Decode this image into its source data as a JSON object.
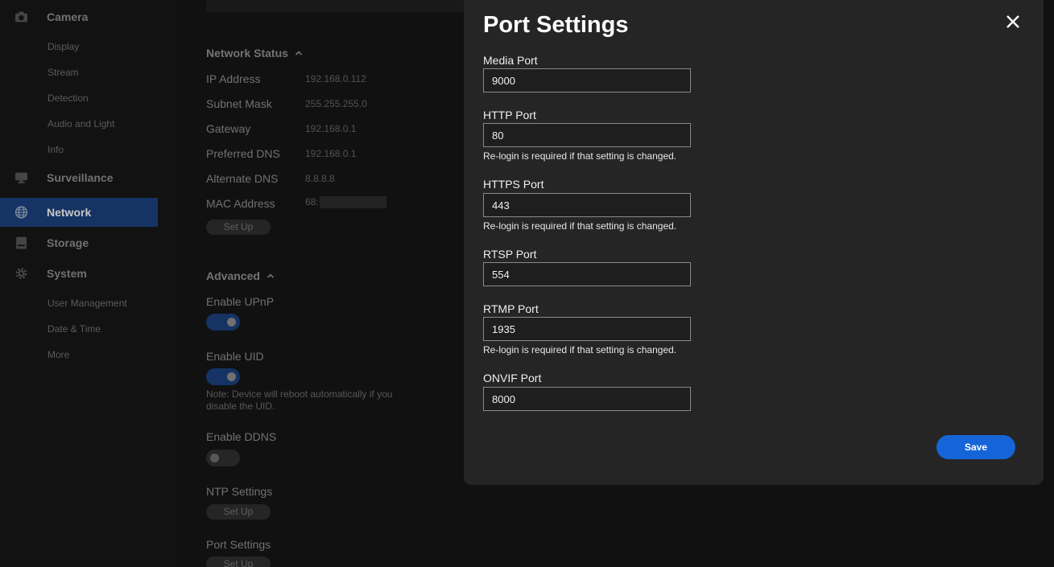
{
  "sidebar": {
    "groups": [
      {
        "label": "Camera",
        "icon": "camera-icon"
      },
      {
        "label": "Surveillance",
        "icon": "monitor-icon"
      },
      {
        "label": "Network",
        "icon": "globe-icon"
      },
      {
        "label": "Storage",
        "icon": "storage-icon"
      },
      {
        "label": "System",
        "icon": "gear-icon"
      }
    ],
    "camera_items": [
      "Display",
      "Stream",
      "Detection",
      "Audio and Light",
      "Info"
    ],
    "system_items": [
      "User Management",
      "Date & Time",
      "More"
    ]
  },
  "main": {
    "network_status": {
      "title": "Network Status",
      "rows": [
        {
          "label": "IP Address",
          "value": "192.168.0.112"
        },
        {
          "label": "Subnet Mask",
          "value": "255.255.255.0"
        },
        {
          "label": "Gateway",
          "value": "192.168.0.1"
        },
        {
          "label": "Preferred DNS",
          "value": "192.168.0.1"
        },
        {
          "label": "Alternate DNS",
          "value": "8.8.8.8"
        },
        {
          "label": "MAC Address",
          "value": "68:"
        }
      ],
      "setup_label": "Set Up"
    },
    "advanced": {
      "title": "Advanced",
      "upnp_label": "Enable UPnP",
      "uid_label": "Enable UID",
      "uid_note": "Note: Device will reboot automatically if you disable the UID.",
      "ddns_label": "Enable DDNS",
      "ntp_label": "NTP Settings",
      "ntp_setup": "Set Up",
      "port_label": "Port Settings",
      "port_setup": "Set Up"
    }
  },
  "modal": {
    "title": "Port Settings",
    "fields": [
      {
        "label": "Media Port",
        "value": "9000",
        "hint": ""
      },
      {
        "label": "HTTP Port",
        "value": "80",
        "hint": "Re-login is required if that setting is changed."
      },
      {
        "label": "HTTPS Port",
        "value": "443",
        "hint": "Re-login is required if that setting is changed."
      },
      {
        "label": "RTSP Port",
        "value": "554",
        "hint": ""
      },
      {
        "label": "RTMP Port",
        "value": "1935",
        "hint": "Re-login is required if that setting is changed."
      },
      {
        "label": "ONVIF Port",
        "value": "8000",
        "hint": ""
      }
    ],
    "save_label": "Save"
  },
  "colors": {
    "accent": "#1565d8",
    "active_nav": "#1a3f7a"
  }
}
